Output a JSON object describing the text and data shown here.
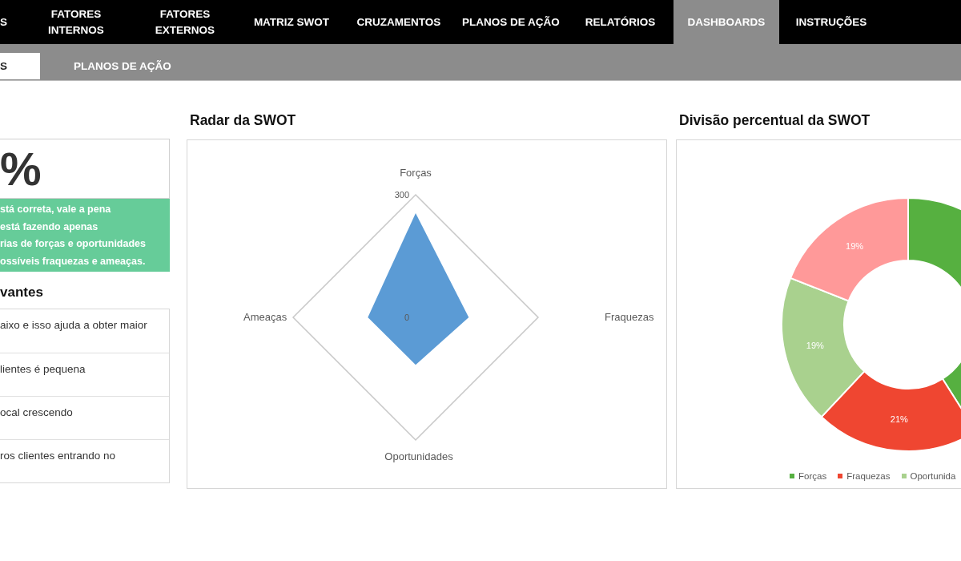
{
  "top_nav": [
    {
      "label": "S",
      "selected": false
    },
    {
      "label": "FATORES INTERNOS",
      "selected": false
    },
    {
      "label": "FATORES EXTERNOS",
      "selected": false
    },
    {
      "label": "MATRIZ SWOT",
      "selected": false
    },
    {
      "label": "CRUZAMENTOS",
      "selected": false
    },
    {
      "label": "PLANOS DE AÇÃO",
      "selected": false
    },
    {
      "label": "RELATÓRIOS",
      "selected": false
    },
    {
      "label": "DASHBOARDS",
      "selected": true
    },
    {
      "label": "INSTRUÇÕES",
      "selected": false
    }
  ],
  "sub_tabs": [
    {
      "label": "S",
      "selected": true
    },
    {
      "label": "PLANOS DE AÇÃO",
      "selected": false
    }
  ],
  "score_card": {
    "value": "%",
    "message_lines": [
      "stá correta, vale a pena",
      "está fazendo apenas",
      "rias de forças e oportunidades",
      "ossíveis fraquezas e ameaças."
    ]
  },
  "list_section": {
    "title": "vantes",
    "items": [
      "aixo e isso ajuda a obter maior",
      "lientes é pequena",
      "ocal crescendo",
      "ros clientes entrando no"
    ]
  },
  "radar_panel": {
    "title": "Radar da SWOT",
    "chart_data": {
      "type": "radar",
      "categories": [
        "Forças",
        "Fraquezas",
        "Oportunidades",
        "Ameaças"
      ],
      "series": [
        {
          "color": "#5b9bd5",
          "values": [
            255,
            130,
            116,
            117
          ]
        }
      ],
      "ylim": [
        0,
        300
      ],
      "yticks": [
        {
          "value": 0,
          "label": "0"
        },
        {
          "value": 300,
          "label": "300"
        }
      ]
    }
  },
  "donut_panel": {
    "title": "Divisão percentual da SWOT",
    "chart_data": {
      "type": "donut",
      "values": [
        41,
        21,
        19,
        19
      ],
      "colors": [
        "#56b040",
        "#ef4631",
        "#a9d18e",
        "#ff9999"
      ],
      "value_labels": [
        null,
        "21%",
        "19%",
        "19%"
      ]
    },
    "legend": [
      {
        "label": "Forças",
        "color": "#56b040"
      },
      {
        "label": "Fraquezas",
        "color": "#ef4631"
      },
      {
        "label": "Oportunida",
        "color": "#a9d18e"
      }
    ]
  }
}
